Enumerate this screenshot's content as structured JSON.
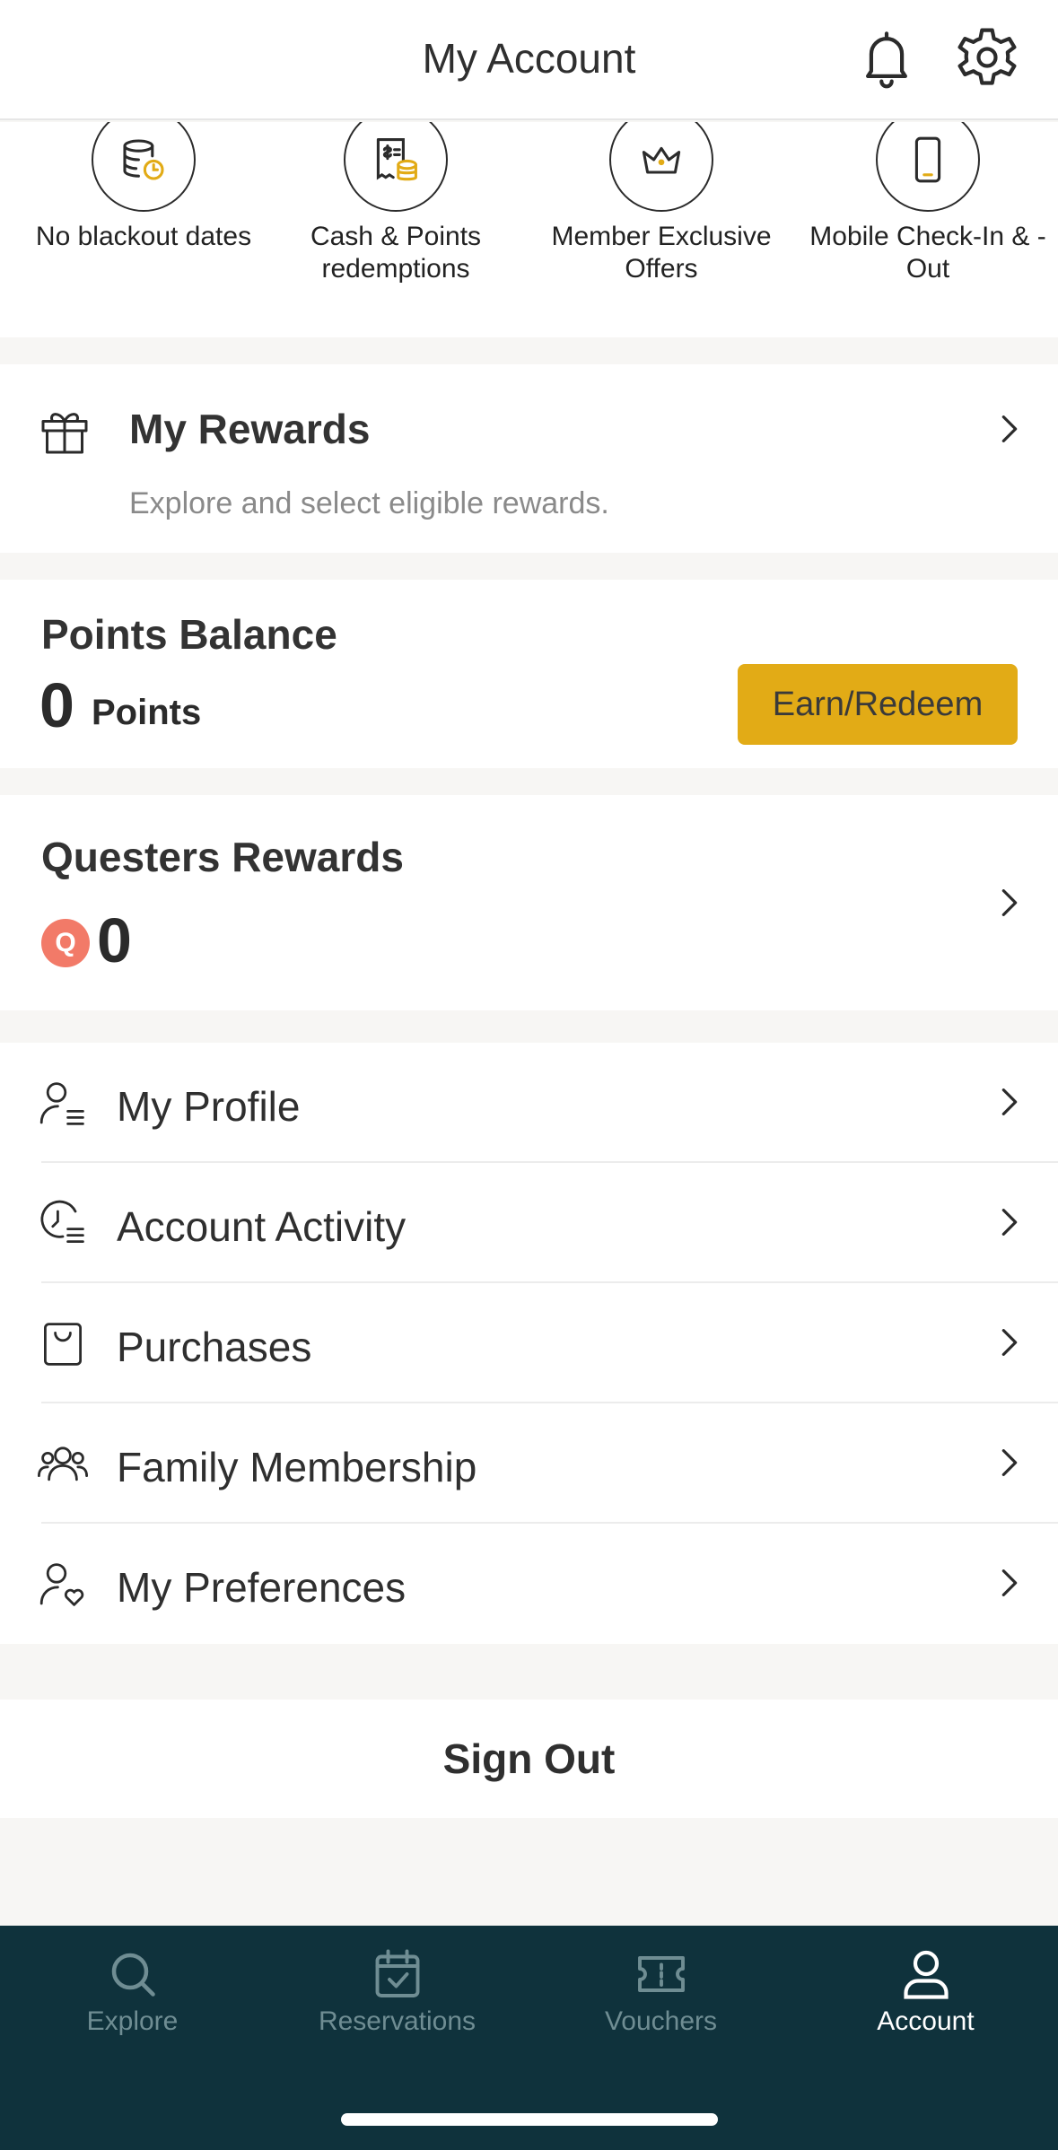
{
  "header": {
    "title": "My Account",
    "icons": [
      "bell-icon",
      "gear-icon"
    ]
  },
  "benefits": [
    {
      "label": "No blackout dates",
      "icon": "database-refresh-icon"
    },
    {
      "label": "Cash & Points redemptions",
      "icon": "receipt-coins-icon"
    },
    {
      "label": "Member Exclusive Offers",
      "icon": "crown-icon"
    },
    {
      "label": "Mobile Check-In & -Out",
      "icon": "mobile-phone-icon"
    }
  ],
  "rewards": {
    "title": "My Rewards",
    "subtitle": "Explore and select eligible rewards."
  },
  "points": {
    "title": "Points Balance",
    "value": "0",
    "unit": "Points",
    "button": "Earn/Redeem"
  },
  "questers": {
    "title": "Questers Rewards",
    "badge": "Q",
    "value": "0"
  },
  "menu": [
    {
      "label": "My Profile",
      "icon": "profile-list-icon"
    },
    {
      "label": "Account Activity",
      "icon": "clock-list-icon"
    },
    {
      "label": "Purchases",
      "icon": "shopping-bag-icon"
    },
    {
      "label": "Family Membership",
      "icon": "group-icon"
    },
    {
      "label": "My Preferences",
      "icon": "user-heart-icon"
    }
  ],
  "signout": "Sign Out",
  "tabs": [
    {
      "label": "Explore",
      "icon": "search-icon",
      "active": false
    },
    {
      "label": "Reservations",
      "icon": "calendar-check-icon",
      "active": false
    },
    {
      "label": "Vouchers",
      "icon": "ticket-icon",
      "active": false
    },
    {
      "label": "Account",
      "icon": "user-icon",
      "active": true
    }
  ],
  "colors": {
    "accent": "#e2ab16",
    "tabbar": "#0f323c",
    "quest_badge": "#f27a68"
  }
}
